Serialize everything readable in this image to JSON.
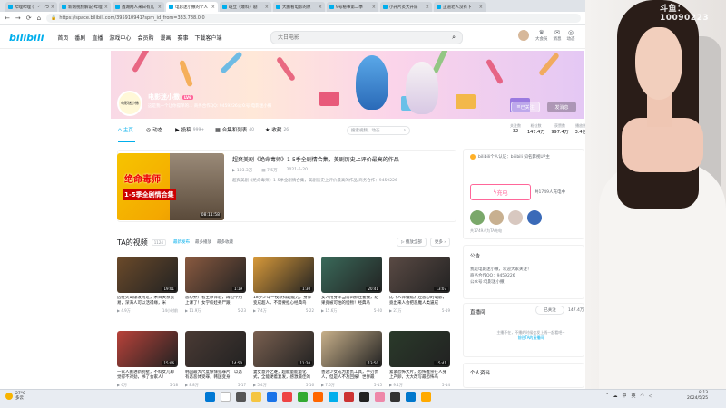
{
  "browser": {
    "tabs": [
      {
        "label": "哔哩哔哩 (゜-゜)つ",
        "active": false
      },
      {
        "label": "新网视频解说-哔哩",
        "active": false
      },
      {
        "label": "鑫湖网人来日有几",
        "active": false
      },
      {
        "label": "电影迷小撒的个人",
        "active": true
      },
      {
        "label": "斑立《爆料》剧",
        "active": false
      },
      {
        "label": "大鹏看电影的原",
        "active": false
      },
      {
        "label": "9号秘事第二季",
        "active": false
      },
      {
        "label": "小开片炎大开扇",
        "active": false
      },
      {
        "label": "正道老人没有下",
        "active": false
      }
    ],
    "url": "https://space.bilibili.com/395910941?spm_id_from=333.788.0.0"
  },
  "header": {
    "logo": "bilibili",
    "nav": [
      "首页",
      "番剧",
      "直播",
      "游戏中心",
      "会员购",
      "漫画",
      "赛事",
      "下载客户端"
    ],
    "search_placeholder": "大日电影",
    "right_icons": [
      {
        "label": "大会员",
        "icon": "crown-icon"
      },
      {
        "label": "消息",
        "icon": "message-icon"
      },
      {
        "label": "动态",
        "icon": "dynamic-icon"
      }
    ]
  },
  "profile": {
    "name": "电影迷小撒",
    "level": "LV6",
    "avatar_text": "电影迷小撒",
    "sign": "这是我一个让你孤单的... 商务合作QQ: 9459226公众号:电影迷小撒",
    "follow_btn": "已关注",
    "message_btn": "发消息",
    "tabs": [
      {
        "label": "主页",
        "count": "",
        "icon": "home-icon",
        "active": true
      },
      {
        "label": "动态",
        "count": "",
        "icon": "dynamic-icon",
        "active": false
      },
      {
        "label": "投稿",
        "count": "999+",
        "icon": "upload-icon",
        "active": false
      },
      {
        "label": "合集和列表",
        "count": "40",
        "icon": "collection-icon",
        "active": false
      },
      {
        "label": "收藏",
        "count": "26",
        "icon": "star-icon",
        "active": false
      }
    ],
    "tab_search_placeholder": "搜索视频、动态",
    "stats": [
      {
        "label": "关注数",
        "value": "32"
      },
      {
        "label": "粉丝数",
        "value": "147.4万"
      },
      {
        "label": "获赞数",
        "value": "997.4万"
      },
      {
        "label": "播放数",
        "value": "3.4亿"
      }
    ]
  },
  "top_video": {
    "cover_text1": "绝命毒师",
    "cover_text2": "1-5季全剧情合集",
    "duration": "08:11:58",
    "title": "超爽美剧《绝命毒师》1-5季全剧情合集，美剧历史上评价最高的作品",
    "views": "103.3万",
    "comments": "7.5万",
    "date": "2021-5-20",
    "desc": "超爽美剧《绝命毒师》1-5季全剧情合集，美剧历史上评价最高的作品 商务合作：9459226"
  },
  "videos_section": {
    "title": "TA的视频",
    "count": "1124",
    "sorts": [
      "最新发布",
      "最多播放",
      "最多收藏"
    ],
    "play_all": "播放全部",
    "more": "更多"
  },
  "videos": [
    {
      "title": "因在火山爆发附近，米日关系贸易，深海人可以活得缘，米",
      "views": "4.9万",
      "date": "14小时前",
      "duration": "19:01",
      "thumb": "#6b4a2a"
    },
    {
      "title": "恶心养尸者生命体验，再也不用上课了！女学校娃养尸跟",
      "views": "11.9万",
      "date": "5-23",
      "duration": "1:19",
      "thumb": "#8a5a40"
    },
    {
      "title": "18岁少年一夜获得超能力，身体变成超人，不需要担心经典鸟",
      "views": "7.4万",
      "date": "5-22",
      "duration": "1:30",
      "thumb": "#d99a3a"
    },
    {
      "title": "女人用身体当诱饵抓住警报，结果竟被可怕的怪物！经典鸟",
      "views": "15.6万",
      "date": "5-20",
      "duration": "20:41",
      "thumb": "#3a6a5a"
    },
    {
      "title": "比《人体蜈蚣》还恶心的电影，竟出来人会把恶魔人类逼成",
      "views": "21万",
      "date": "5-19",
      "duration": "13:07",
      "thumb": "#5a4a44"
    },
    {
      "title": "一家人搬进新别墅，不料女儿却觉得不对劲，书了会家人！",
      "views": "6万",
      "date": "5-18",
      "duration": "15:06",
      "thumb": "#b8423a"
    },
    {
      "title": "韩国最大尺度惊悚犯罪片，以恶有恶恶体受罪，韩国变身",
      "views": "8.8万",
      "date": "5-17",
      "duration": "14:50",
      "thumb": "#4a3a34"
    },
    {
      "title": "妻女意外之难，超能量能量化式，全能硬着复发，感激最佳的",
      "views": "5.4万",
      "date": "5-16",
      "duration": "11:20",
      "thumb": "#7a6050"
    },
    {
      "title": "善恶少女成为复仇工具，手刃仇人，但是人不及回报！世界最",
      "views": "7.6万",
      "date": "5-15",
      "duration": "13:50",
      "thumb": "#c8b08a"
    },
    {
      "title": "紧紧恐怖大片，恐怖推崇在人身上产卵，大大改写最恐怖鸟",
      "views": "9.1万",
      "date": "5-14",
      "duration": "15:41",
      "thumb": "#2a3a2a"
    }
  ],
  "sidebar": {
    "cert": "bilibili个人认证：bilibili 知名影视UP主",
    "charge_btn": "充电",
    "charge_text": "共1749人充电中",
    "fan_text": "共1749人为TA充电",
    "notice_title": "公告",
    "notice_lines": [
      "我是电影迷小撒，欢迎大家关注！",
      "商务合作QQ：9459226",
      "公众号:电影迷小撒"
    ],
    "live_title": "直播间",
    "live_btn": "已关注",
    "live_count": "147.4万",
    "live_body1": "主播不在，不播的时候会发上线一起看吧~",
    "live_link": "前往TA的直播间",
    "personal_info": "个人资料"
  },
  "webcam": {
    "label": "斗鱼：10090223"
  },
  "taskbar": {
    "weather_temp": "27°C",
    "weather_desc": "多云",
    "tray": [
      "中",
      "英"
    ],
    "time": "8:13",
    "date": "2024/5/25"
  }
}
